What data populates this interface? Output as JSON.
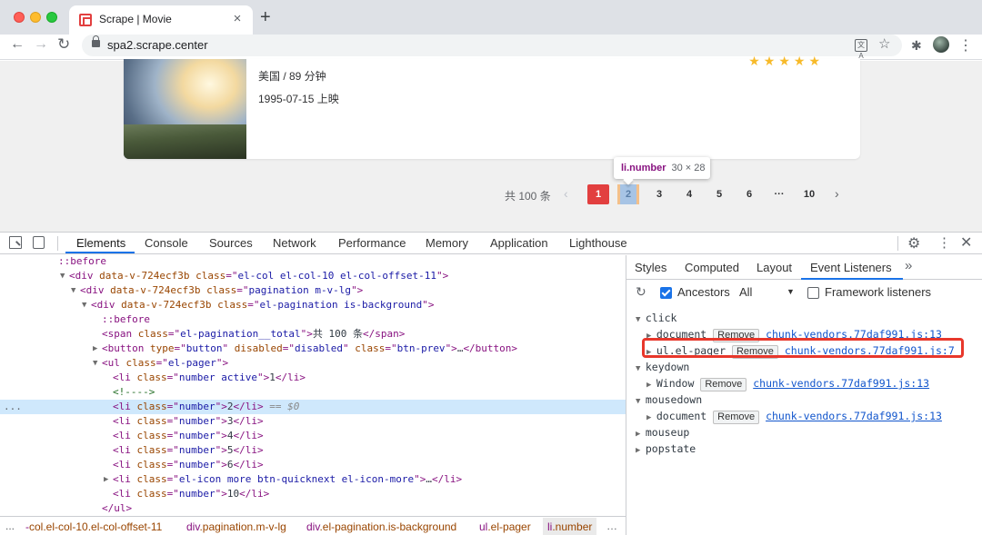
{
  "browser": {
    "tab_title": "Scrape | Movie",
    "tab_close": "×",
    "new_tab": "+",
    "url": "spa2.scrape.center",
    "back": "←",
    "forward": "→",
    "reload": "↻",
    "translate_glyph": "文A",
    "star": "☆",
    "extensions": "✱",
    "menu": "⋮"
  },
  "movie": {
    "region_duration": "美国 / 89 分钟",
    "release": "1995-07-15 上映",
    "stars": "★★★★★"
  },
  "pagination": {
    "total": "共 100 条",
    "prev": "‹",
    "next": "›",
    "pages": [
      "1",
      "2",
      "3",
      "4",
      "5",
      "6",
      "···",
      "10"
    ],
    "active": "1",
    "hovered": "2"
  },
  "tooltip": {
    "tag": "li.number",
    "dims": "30 × 28"
  },
  "devtools": {
    "tabs": [
      "Elements",
      "Console",
      "Sources",
      "Network",
      "Performance",
      "Memory",
      "Application",
      "Lighthouse"
    ],
    "active_tab": "Elements",
    "gear": "⚙",
    "kebab": "⋮",
    "close": "✕",
    "dom_lines": [
      {
        "indent": 0,
        "tri": "",
        "parts": [
          {
            "k": "ps",
            "t": "::before"
          }
        ]
      },
      {
        "indent": 1,
        "tri": "▼",
        "parts": [
          {
            "k": "t",
            "t": "<div "
          },
          {
            "k": "a",
            "t": "data-v-724ecf3b "
          },
          {
            "k": "a",
            "t": "class"
          },
          {
            "k": "t",
            "t": "=\""
          },
          {
            "k": "v",
            "t": "el-col el-col-10 el-col-offset-11"
          },
          {
            "k": "t",
            "t": "\">"
          }
        ]
      },
      {
        "indent": 2,
        "tri": "▼",
        "parts": [
          {
            "k": "t",
            "t": "<div "
          },
          {
            "k": "a",
            "t": "data-v-724ecf3b "
          },
          {
            "k": "a",
            "t": "class"
          },
          {
            "k": "t",
            "t": "=\""
          },
          {
            "k": "v",
            "t": "pagination m-v-lg"
          },
          {
            "k": "t",
            "t": "\">"
          }
        ]
      },
      {
        "indent": 3,
        "tri": "▼",
        "parts": [
          {
            "k": "t",
            "t": "<div "
          },
          {
            "k": "a",
            "t": "data-v-724ecf3b "
          },
          {
            "k": "a",
            "t": "class"
          },
          {
            "k": "t",
            "t": "=\""
          },
          {
            "k": "v",
            "t": "el-pagination is-background"
          },
          {
            "k": "t",
            "t": "\">"
          }
        ]
      },
      {
        "indent": 4,
        "tri": "",
        "parts": [
          {
            "k": "ps",
            "t": "::before"
          }
        ]
      },
      {
        "indent": 4,
        "tri": "",
        "parts": [
          {
            "k": "t",
            "t": "<span "
          },
          {
            "k": "a",
            "t": "class"
          },
          {
            "k": "t",
            "t": "=\""
          },
          {
            "k": "v",
            "t": "el-pagination__total"
          },
          {
            "k": "t",
            "t": "\">"
          },
          {
            "k": "x",
            "t": "共 100 条"
          },
          {
            "k": "t",
            "t": "</span>"
          }
        ]
      },
      {
        "indent": 4,
        "tri": "▶",
        "parts": [
          {
            "k": "t",
            "t": "<button "
          },
          {
            "k": "a",
            "t": "type"
          },
          {
            "k": "t",
            "t": "=\""
          },
          {
            "k": "v",
            "t": "button"
          },
          {
            "k": "t",
            "t": "\" "
          },
          {
            "k": "a",
            "t": "disabled"
          },
          {
            "k": "t",
            "t": "=\""
          },
          {
            "k": "v",
            "t": "disabled"
          },
          {
            "k": "t",
            "t": "\" "
          },
          {
            "k": "a",
            "t": "class"
          },
          {
            "k": "t",
            "t": "=\""
          },
          {
            "k": "v",
            "t": "btn-prev"
          },
          {
            "k": "t",
            "t": "\">"
          },
          {
            "k": "x",
            "t": "…"
          },
          {
            "k": "t",
            "t": "</button>"
          }
        ]
      },
      {
        "indent": 4,
        "tri": "▼",
        "parts": [
          {
            "k": "t",
            "t": "<ul "
          },
          {
            "k": "a",
            "t": "class"
          },
          {
            "k": "t",
            "t": "=\""
          },
          {
            "k": "v",
            "t": "el-pager"
          },
          {
            "k": "t",
            "t": "\">"
          }
        ]
      },
      {
        "indent": 5,
        "tri": "",
        "parts": [
          {
            "k": "t",
            "t": "<li "
          },
          {
            "k": "a",
            "t": "class"
          },
          {
            "k": "t",
            "t": "=\""
          },
          {
            "k": "v",
            "t": "number active"
          },
          {
            "k": "t",
            "t": "\">"
          },
          {
            "k": "x",
            "t": "1"
          },
          {
            "k": "t",
            "t": "</li>"
          }
        ]
      },
      {
        "indent": 5,
        "tri": "",
        "parts": [
          {
            "k": "cm",
            "t": "<!---->"
          }
        ]
      },
      {
        "indent": 5,
        "tri": "",
        "selected": true,
        "parts": [
          {
            "k": "t",
            "t": "<li "
          },
          {
            "k": "a",
            "t": "class"
          },
          {
            "k": "t",
            "t": "=\""
          },
          {
            "k": "v",
            "t": "number"
          },
          {
            "k": "t",
            "t": "\">"
          },
          {
            "k": "x",
            "t": "2"
          },
          {
            "k": "t",
            "t": "</li>"
          },
          {
            "k": "eq",
            "t": " == $0"
          }
        ]
      },
      {
        "indent": 5,
        "tri": "",
        "parts": [
          {
            "k": "t",
            "t": "<li "
          },
          {
            "k": "a",
            "t": "class"
          },
          {
            "k": "t",
            "t": "=\""
          },
          {
            "k": "v",
            "t": "number"
          },
          {
            "k": "t",
            "t": "\">"
          },
          {
            "k": "x",
            "t": "3"
          },
          {
            "k": "t",
            "t": "</li>"
          }
        ]
      },
      {
        "indent": 5,
        "tri": "",
        "parts": [
          {
            "k": "t",
            "t": "<li "
          },
          {
            "k": "a",
            "t": "class"
          },
          {
            "k": "t",
            "t": "=\""
          },
          {
            "k": "v",
            "t": "number"
          },
          {
            "k": "t",
            "t": "\">"
          },
          {
            "k": "x",
            "t": "4"
          },
          {
            "k": "t",
            "t": "</li>"
          }
        ]
      },
      {
        "indent": 5,
        "tri": "",
        "parts": [
          {
            "k": "t",
            "t": "<li "
          },
          {
            "k": "a",
            "t": "class"
          },
          {
            "k": "t",
            "t": "=\""
          },
          {
            "k": "v",
            "t": "number"
          },
          {
            "k": "t",
            "t": "\">"
          },
          {
            "k": "x",
            "t": "5"
          },
          {
            "k": "t",
            "t": "</li>"
          }
        ]
      },
      {
        "indent": 5,
        "tri": "",
        "parts": [
          {
            "k": "t",
            "t": "<li "
          },
          {
            "k": "a",
            "t": "class"
          },
          {
            "k": "t",
            "t": "=\""
          },
          {
            "k": "v",
            "t": "number"
          },
          {
            "k": "t",
            "t": "\">"
          },
          {
            "k": "x",
            "t": "6"
          },
          {
            "k": "t",
            "t": "</li>"
          }
        ]
      },
      {
        "indent": 5,
        "tri": "▶",
        "parts": [
          {
            "k": "t",
            "t": "<li "
          },
          {
            "k": "a",
            "t": "class"
          },
          {
            "k": "t",
            "t": "=\""
          },
          {
            "k": "v",
            "t": "el-icon more btn-quicknext el-icon-more"
          },
          {
            "k": "t",
            "t": "\">"
          },
          {
            "k": "x",
            "t": "…"
          },
          {
            "k": "t",
            "t": "</li>"
          }
        ]
      },
      {
        "indent": 5,
        "tri": "",
        "parts": [
          {
            "k": "t",
            "t": "<li "
          },
          {
            "k": "a",
            "t": "class"
          },
          {
            "k": "t",
            "t": "=\""
          },
          {
            "k": "v",
            "t": "number"
          },
          {
            "k": "t",
            "t": "\">"
          },
          {
            "k": "x",
            "t": "10"
          },
          {
            "k": "t",
            "t": "</li>"
          }
        ]
      },
      {
        "indent": 4,
        "tri": "",
        "parts": [
          {
            "k": "t",
            "t": "</ul>"
          }
        ]
      }
    ],
    "breadcrumbs": [
      {
        "tag": "",
        "cls": "col.el-col-10.el-col-offset-11"
      },
      {
        "tag": "div",
        "cls": ".pagination.m-v-lg"
      },
      {
        "tag": "div",
        "cls": ".el-pagination.is-background"
      },
      {
        "tag": "ul",
        "cls": ".el-pager"
      },
      {
        "tag": "li",
        "cls": ".number"
      }
    ],
    "crumb_prefix": "-",
    "ellipsis": "…",
    "sidebar": {
      "tabs": [
        "Styles",
        "Computed",
        "Layout",
        "Event Listeners"
      ],
      "active_tab": "Event Listeners",
      "more": "»",
      "ancestors_label": "Ancestors",
      "ancestors_checked": true,
      "filter_value": "All",
      "framework_label": "Framework listeners",
      "framework_checked": false,
      "remove_label": "Remove",
      "events": [
        {
          "type": "click",
          "listeners": [
            {
              "target": "document",
              "src": "chunk-vendors.77daf991.js:13"
            },
            {
              "target": "ul.el-pager",
              "src": "chunk-vendors.77daf991.js:7"
            }
          ]
        },
        {
          "type": "keydown",
          "listeners": [
            {
              "target": "Window",
              "src": "chunk-vendors.77daf991.js:13"
            }
          ]
        },
        {
          "type": "mousedown",
          "listeners": [
            {
              "target": "document",
              "src": "chunk-vendors.77daf991.js:13"
            }
          ]
        },
        {
          "type": "mouseup",
          "listeners": []
        },
        {
          "type": "popstate",
          "listeners": []
        }
      ]
    }
  },
  "colors": {
    "accent_red": "#e23f3f",
    "devtools_blue": "#1a73e8",
    "highlight_red": "#e8372b"
  }
}
